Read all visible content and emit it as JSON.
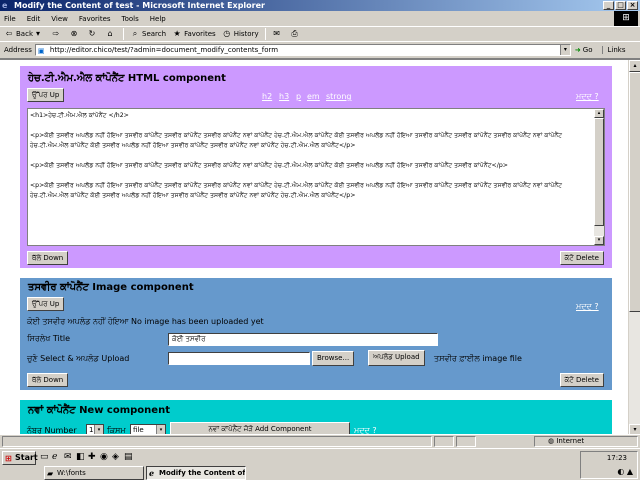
{
  "window": {
    "title": "Modify the Content of test - Microsoft Internet Explorer",
    "controls": [
      "_",
      "□",
      "×"
    ]
  },
  "menubar": [
    "File",
    "Edit",
    "View",
    "Favorites",
    "Tools",
    "Help"
  ],
  "toolbar": {
    "back": "Back",
    "search": "Search",
    "favorites": "Favorites",
    "history": "History"
  },
  "address": {
    "label": "Address",
    "url": "http://editor.chico/test/?admin=document_modify_contents_form",
    "go": "Go",
    "links": "Links"
  },
  "html_component": {
    "title": "ਹੇਚ.ਟੀ.ਐਮ.ਐਲ ਕਾਂਪੋਨੈਂਟ HTML component",
    "up_button": "ਉੱਪਰ Up",
    "tag_links": [
      "h2",
      "h3",
      "p",
      "em",
      "strong"
    ],
    "help": "ਮਦਦ ?",
    "content": "<h1>ਹੇਚ.ਟੀ.ਐਮ.ਐਲ ਕਾਂਪੋਨੈਂਟ </h2>\n\n<p>ਕੋਈ ਤਸਵੀਰ ਅਪਲੋਡ ਨਹੀਂ ਹੋਇਆ ਤਸਵੀਰ ਕਾਂਪੋਨੈਂਟ ਤਸਵੀਰ ਕਾਂਪੋਨੈਂਟ ਤਸਵੀਰ ਕਾਂਪੋਨੈਂਟ ਨਵਾਂ ਕਾਂਪੋਨੈਂਟ ਹੇਚ.ਟੀ.ਐਮ.ਐਲ ਕਾਂਪੋਨੈਂਟ ਕੋਈ ਤਸਵੀਰ ਅਪਲੋਡ ਨਹੀਂ ਹੋਇਆ ਤਸਵੀਰ ਕਾਂਪੋਨੈਂਟ ਤਸਵੀਰ ਕਾਂਪੋਨੈਂਟ ਤਸਵੀਰ ਕਾਂਪੋਨੈਂਟ ਨਵਾਂ ਕਾਂਪੋਨੈਂਟ ਹੇਚ.ਟੀ.ਐਮ.ਐਲ ਕਾਂਪੋਨੈਂਟ ਕੋਈ ਤਸਵੀਰ ਅਪਲੋਡ ਨਹੀਂ ਹੋਇਆ ਤਸਵੀਰ ਕਾਂਪੋਨੈਂਟ ਤਸਵੀਰ ਕਾਂਪੋਨੈਂਟ ਨਵਾਂ ਕਾਂਪੋਨੈਂਟ ਹੇਚ.ਟੀ.ਐਮ.ਐਲ ਕਾਂਪੋਨੈਂਟ</p>\n\n<p>ਕੋਈ ਤਸਵੀਰ ਅਪਲੋਡ ਨਹੀਂ ਹੋਇਆ ਤਸਵੀਰ ਕਾਂਪੋਨੈਂਟ ਤਸਵੀਰ ਕਾਂਪੋਨੈਂਟ ਤਸਵੀਰ ਕਾਂਪੋਨੈਂਟ ਨਵਾਂ ਕਾਂਪੋਨੈਂਟ ਹੇਚ.ਟੀ.ਐਮ.ਐਲ ਕਾਂਪੋਨੈਂਟ ਕੋਈ ਤਸਵੀਰ ਅਪਲੋਡ ਨਹੀਂ ਹੋਇਆ ਤਸਵੀਰ ਕਾਂਪੋਨੈਂਟ ਤਸਵੀਰ ਕਾਂਪੋਨੈਂਟ</p>\n\n<p>ਕੋਈ ਤਸਵੀਰ ਅਪਲੋਡ ਨਹੀਂ ਹੋਇਆ ਤਸਵੀਰ ਕਾਂਪੋਨੈਂਟ ਤਸਵੀਰ ਕਾਂਪੋਨੈਂਟ ਤਸਵੀਰ ਕਾਂਪੋਨੈਂਟ ਨਵਾਂ ਕਾਂਪੋਨੈਂਟ ਹੇਚ.ਟੀ.ਐਮ.ਐਲ ਕਾਂਪੋਨੈਂਟ ਕੋਈ ਤਸਵੀਰ ਅਪਲੋਡ ਨਹੀਂ ਹੋਇਆ ਤਸਵੀਰ ਕਾਂਪੋਨੈਂਟ ਤਸਵੀਰ ਕਾਂਪੋਨੈਂਟ ਤਸਵੀਰ ਕਾਂਪੋਨੈਂਟ ਨਵਾਂ ਕਾਂਪੋਨੈਂਟ ਹੇਚ.ਟੀ.ਐਮ.ਐਲ ਕਾਂਪੋਨੈਂਟ ਕੋਈ ਤਸਵੀਰ ਅਪਲੋਡ ਨਹੀਂ ਹੋਇਆ ਤਸਵੀਰ ਕਾਂਪੋਨੈਂਟ ਤਸਵੀਰ ਕਾਂਪੋਨੈਂਟ ਨਵਾਂ ਕਾਂਪੋਨੈਂਟ ਹੇਚ.ਟੀ.ਐਮ.ਐਲ ਕਾਂਪੋਨੈਂਟ</p>",
    "down_button": "ਥੱਲੇ Down",
    "delete_button": "ਕੱਟੋ Delete",
    "bg_color": "#cc99ff"
  },
  "image_component": {
    "title": "ਤਸਵੀਰ ਕਾਂਪੋਨੈਂਟ Image component",
    "up_button": "ਉੱਪਰ Up",
    "help": "ਮਦਦ ?",
    "no_image_text": "ਕੋਈ ਤਸਵੀਰ ਅਪਲੋਡ ਨਹੀਂ ਹੋਇਆ No image has been uploaded yet",
    "title_label": "ਸਿਰਲੇਖ Title",
    "title_value": "ਕੋਈ ਤਸਵੀਰ",
    "upload_label": "ਚੁਣੋ Select & ਅਪਲੋਡ Upload",
    "browse_button": "Browse...",
    "upload_button": "ਅਪਲੋਡ Upload",
    "file_hint": "ਤਸਵੀਰ ਫ਼ਾਈਲ image file",
    "down_button": "ਥੱਲੇ Down",
    "delete_button": "ਕੱਟੋ Delete",
    "bg_color": "#6699cc"
  },
  "new_component": {
    "title": "ਨਵਾਂ ਕਾਂਪੋਨੈਂਟ New component",
    "number_label": "ਨੰਬਰ Number",
    "number_value": "1",
    "type_label": "ਕਿਸਮ",
    "type_value": "file",
    "add_button": "ਨਵਾਂ ਕਾਂਪੋਨੈਂਟ ਜੋੜੋ Add Component",
    "help": "ਮਦਦ ?",
    "bg_color": "#00cccc"
  },
  "statusbar": {
    "zone": "Internet"
  },
  "taskbar": {
    "start": "Start",
    "tasks": [
      "W:\\fonts",
      "Modify the Content of ..."
    ],
    "clock": "17:23"
  }
}
